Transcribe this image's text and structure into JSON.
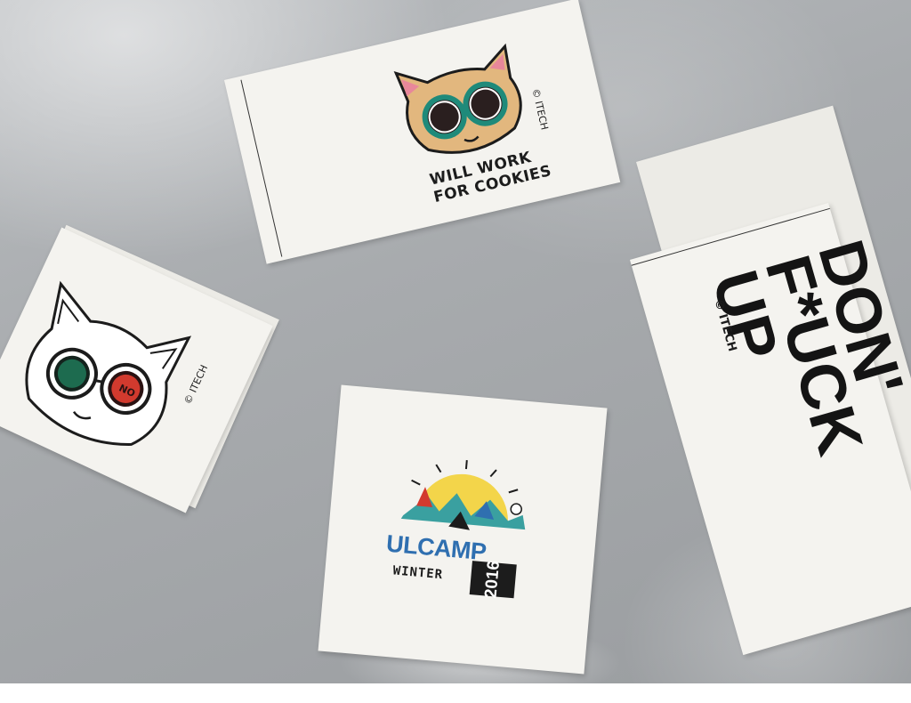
{
  "photo": {
    "stickers": [
      {
        "id": "cookies",
        "caption_line1": "WILL WORK",
        "caption_line2": "FOR COOKIES",
        "copyright": "© ITECH"
      },
      {
        "id": "no-cat",
        "eye_text": "NO",
        "copyright": "© ITECH"
      },
      {
        "id": "ulcamp",
        "title": "ULCAMP",
        "subtitle": "WINTER",
        "year": "2016"
      },
      {
        "id": "dont",
        "line1": "DON'",
        "line2": "F*UCK",
        "line3": "UP",
        "copyright": "© ITECH"
      }
    ]
  },
  "colors": {
    "surface": "#a8abae",
    "paper": "#f4f3ef",
    "cat_fill": "#e2b77e",
    "lens_teal": "#1f8a7a",
    "ulcamp_blue": "#2f6fb0",
    "sun_yellow": "#f3d54a"
  }
}
